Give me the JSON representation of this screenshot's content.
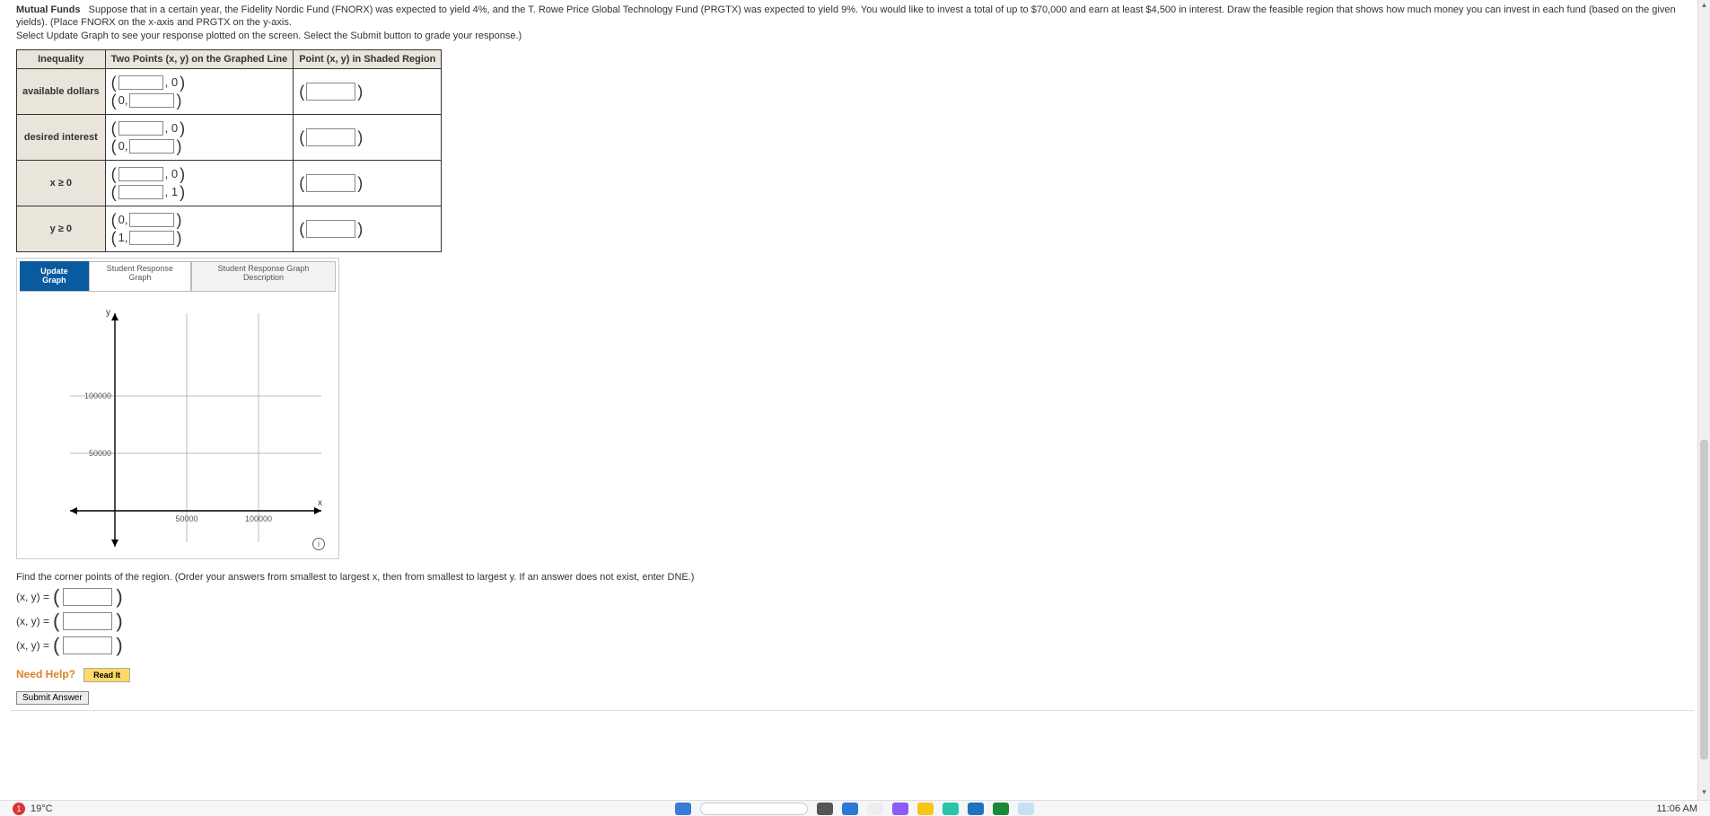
{
  "problem": {
    "title": "Mutual Funds",
    "body1": "Suppose that in a certain year, the Fidelity Nordic Fund (FNORX) was expected to yield 4%, and the T. Rowe Price Global Technology Fund (PRGTX) was expected to yield 9%. You would like to invest a total of up to $70,000 and earn at least $4,500 in interest. Draw the feasible region that shows how much money you can invest in each fund (based on the given yields). (Place FNORX on the x-axis and PRGTX on the y-axis.",
    "body2": "Select Update Graph to see your response plotted on the screen. Select the Submit button to grade your response.)"
  },
  "table": {
    "headers": {
      "h1": "Inequality",
      "h2": "Two Points (x, y) on the Graphed Line",
      "h3": "Point (x, y) in Shaded Region"
    },
    "rows": {
      "r1": {
        "label": "available dollars",
        "a1_suffix": ", 0",
        "a2_prefix": "0,"
      },
      "r2": {
        "label": "desired interest",
        "a1_suffix": ", 0",
        "a2_prefix": "0,"
      },
      "r3": {
        "label": "x ≥ 0",
        "a1_suffix": ", 0",
        "a2_suffix_b": ", 1"
      },
      "r4": {
        "label": "y ≥ 0",
        "a1_prefix": "0,",
        "a2_prefix_b": "1,"
      }
    }
  },
  "graph": {
    "buttons": {
      "update": "Update Graph",
      "tab1": "Student Response Graph",
      "tab2": "Student Response Graph Description"
    },
    "axis": {
      "x_label": "x",
      "y_label": "y",
      "tick_50k": "50000",
      "tick_100k": "100000"
    },
    "info_glyph": "i"
  },
  "corners": {
    "intro": "Find the corner points of the region. (Order your answers from smallest to largest x, then from smallest to largest y. If an answer does not exist, enter DNE.)",
    "label": "(x, y)  ="
  },
  "help": {
    "need": "Need Help?",
    "read": "Read It"
  },
  "submit": {
    "label": "Submit Answer"
  },
  "taskbar": {
    "temp_badge": "1",
    "temp": "19°C",
    "time": "11:06 AM"
  },
  "chart_data": {
    "type": "line",
    "title": "",
    "xlabel": "x",
    "ylabel": "y",
    "xlim": [
      -20000,
      120000
    ],
    "ylim": [
      -20000,
      120000
    ],
    "x_ticks": [
      50000,
      100000
    ],
    "y_ticks": [
      50000,
      100000
    ],
    "series": [],
    "note": "Blank coordinate plane with gridlines at 50000 and 100000 on both axes; no data plotted."
  }
}
